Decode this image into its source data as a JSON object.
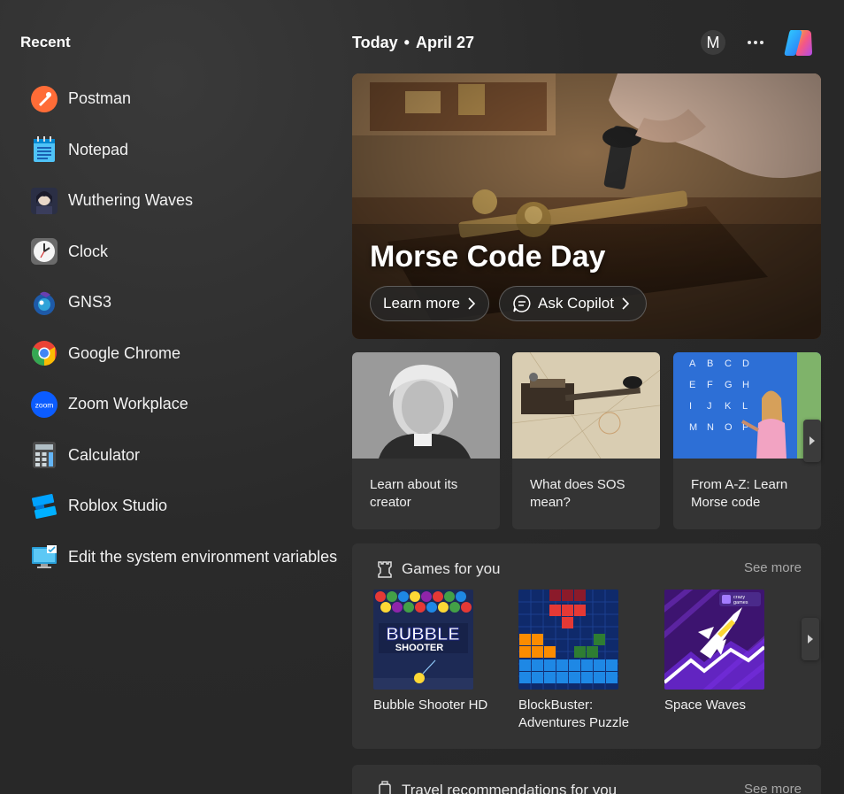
{
  "recent": {
    "title": "Recent",
    "items": [
      {
        "label": "Postman",
        "icon": "postman-icon"
      },
      {
        "label": "Notepad",
        "icon": "notepad-icon"
      },
      {
        "label": "Wuthering Waves",
        "icon": "wuthering-waves-icon"
      },
      {
        "label": "Clock",
        "icon": "clock-icon"
      },
      {
        "label": "GNS3",
        "icon": "gns3-icon"
      },
      {
        "label": "Google Chrome",
        "icon": "chrome-icon"
      },
      {
        "label": "Zoom Workplace",
        "icon": "zoom-icon"
      },
      {
        "label": "Calculator",
        "icon": "calculator-icon"
      },
      {
        "label": "Roblox Studio",
        "icon": "roblox-studio-icon"
      },
      {
        "label": "Edit the system environment variables",
        "icon": "system-settings-icon"
      }
    ]
  },
  "header": {
    "today": "Today",
    "date": "April 27",
    "avatar_letter": "M"
  },
  "hero": {
    "title": "Morse Code Day",
    "learn_more": "Learn more",
    "ask_copilot": "Ask Copilot"
  },
  "cards": [
    {
      "text": "Learn about its creator"
    },
    {
      "text": "What does SOS mean?"
    },
    {
      "text": "From A-Z: Learn Morse code"
    }
  ],
  "games": {
    "title": "Games for you",
    "see_more": "See more",
    "items": [
      {
        "label": "Bubble Shooter HD",
        "thumb_text": "BUBBLE",
        "thumb_sub": "SHOOTER"
      },
      {
        "label": "BlockBuster: Adventures Puzzle"
      },
      {
        "label": "Space Waves",
        "badge": "crazy games"
      }
    ]
  },
  "travel": {
    "title": "Travel recommendations for you",
    "see_more": "See more"
  },
  "colors": {
    "background": "#272727",
    "panel": "#333333",
    "accent_chrome_red": "#ea4335",
    "postman_orange": "#ff6c37",
    "zoom_blue": "#0b5cff"
  }
}
